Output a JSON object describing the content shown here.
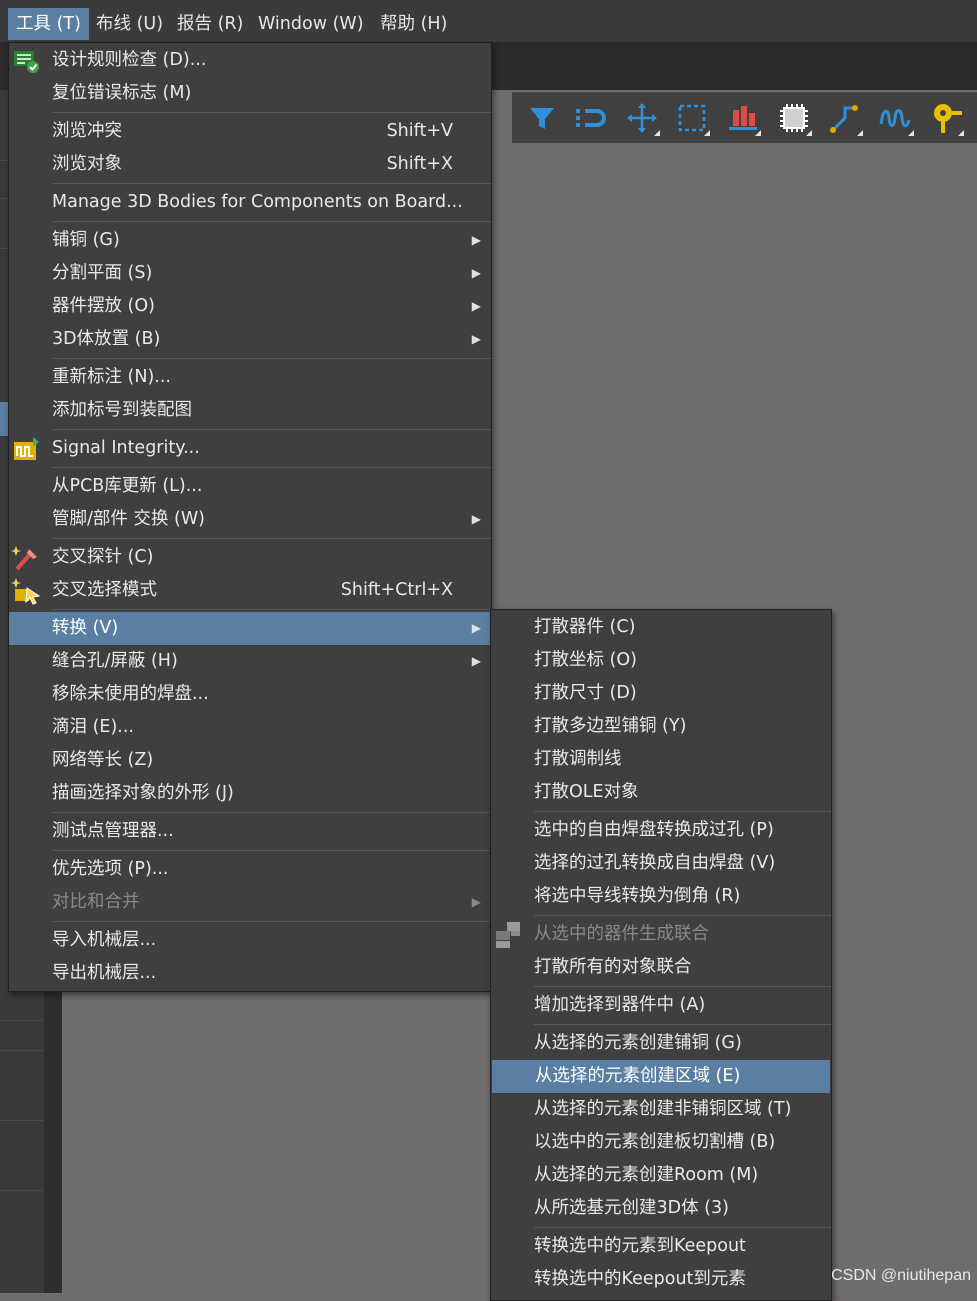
{
  "menubar": {
    "tools": "工具 (T)",
    "route": "布线 (U)",
    "reports": "报告 (R)",
    "window": "Window (W)",
    "help": "帮助 (H)"
  },
  "tools_menu": {
    "design_rule_check": "设计规则检查 (D)...",
    "reset_error_markers": "复位错误标志 (M)",
    "browse_conflicts": "浏览冲突",
    "browse_conflicts_shortcut": "Shift+V",
    "browse_objects": "浏览对象",
    "browse_objects_shortcut": "Shift+X",
    "manage_3d_bodies": "Manage 3D Bodies for Components on Board...",
    "polygon_pours": "铺铜 (G)",
    "split_planes": "分割平面 (S)",
    "component_placement": "器件摆放 (O)",
    "body_3d_placement": "3D体放置 (B)",
    "re_annotate": "重新标注 (N)...",
    "add_designators_to_assembly": "添加标号到装配图",
    "signal_integrity": "Signal Integrity...",
    "update_from_pcb_libraries": "从PCB库更新 (L)...",
    "pin_part_swapping": "管脚/部件 交换 (W)",
    "cross_probe": "交叉探针 (C)",
    "cross_select_mode": "交叉选择模式",
    "cross_select_mode_shortcut": "Shift+Ctrl+X",
    "convert": "转换 (V)",
    "via_stitching_shielding": "缝合孔/屏蔽 (H)",
    "remove_unused_pads": "移除未使用的焊盘...",
    "teardrops": "滴泪 (E)...",
    "net_equalization": "网络等长 (Z)",
    "outline_selected_objects": "描画选择对象的外形 (J)",
    "testpoint_manager": "测试点管理器...",
    "preferences": "优先选项 (P)...",
    "compare_and_merge": "对比和合并",
    "import_mechanical_layers": "导入机械层...",
    "export_mechanical_layers": "导出机械层..."
  },
  "convert_submenu": {
    "explode_component": "打散器件 (C)",
    "explode_coordinate": "打散坐标 (O)",
    "explode_dimension": "打散尺寸 (D)",
    "explode_polygon": "打散多边型铺铜 (Y)",
    "explode_tuning": "打散调制线",
    "explode_ole": "打散OLE对象",
    "pads_to_vias": "选中的自由焊盘转换成过孔 (P)",
    "vias_to_pads": "选择的过孔转换成自由焊盘 (V)",
    "tracks_to_chamfer": "将选中导线转换为倒角 (R)",
    "union_from_components": "从选中的器件生成联合",
    "break_all_unions": "打散所有的对象联合",
    "add_selection_to_component": "增加选择到器件中 (A)",
    "polygon_from_primitives": "从选择的元素创建铺铜 (G)",
    "region_from_primitives": "从选择的元素创建区域 (E)",
    "non_copper_region": "从选择的元素创建非铺铜区域 (T)",
    "board_cutout": "以选中的元素创建板切割槽 (B)",
    "room_from_primitives": "从选择的元素创建Room (M)",
    "body_3d_from_primitives": "从所选基元创建3D体 (3)",
    "primitives_to_keepout": "转换选中的元素到Keepout",
    "keepout_to_primitives": "转换选中的Keepout到元素"
  },
  "watermark": "CSDN @niutihepan",
  "colors": {
    "highlight": "#5b7fa3",
    "menu_bg": "#3f3f3f",
    "canvas_bg": "#6f6c6c"
  },
  "icons": {
    "toolbar": [
      "filter-icon",
      "route-icon",
      "move-icon",
      "select-rect-icon",
      "align-icon",
      "component-icon",
      "route-tool-icon",
      "tuning-icon",
      "place-pad-icon"
    ],
    "menu": [
      "drc-icon",
      "signal-integrity-icon",
      "cross-probe-icon",
      "cross-select-icon",
      "union-icon"
    ]
  }
}
